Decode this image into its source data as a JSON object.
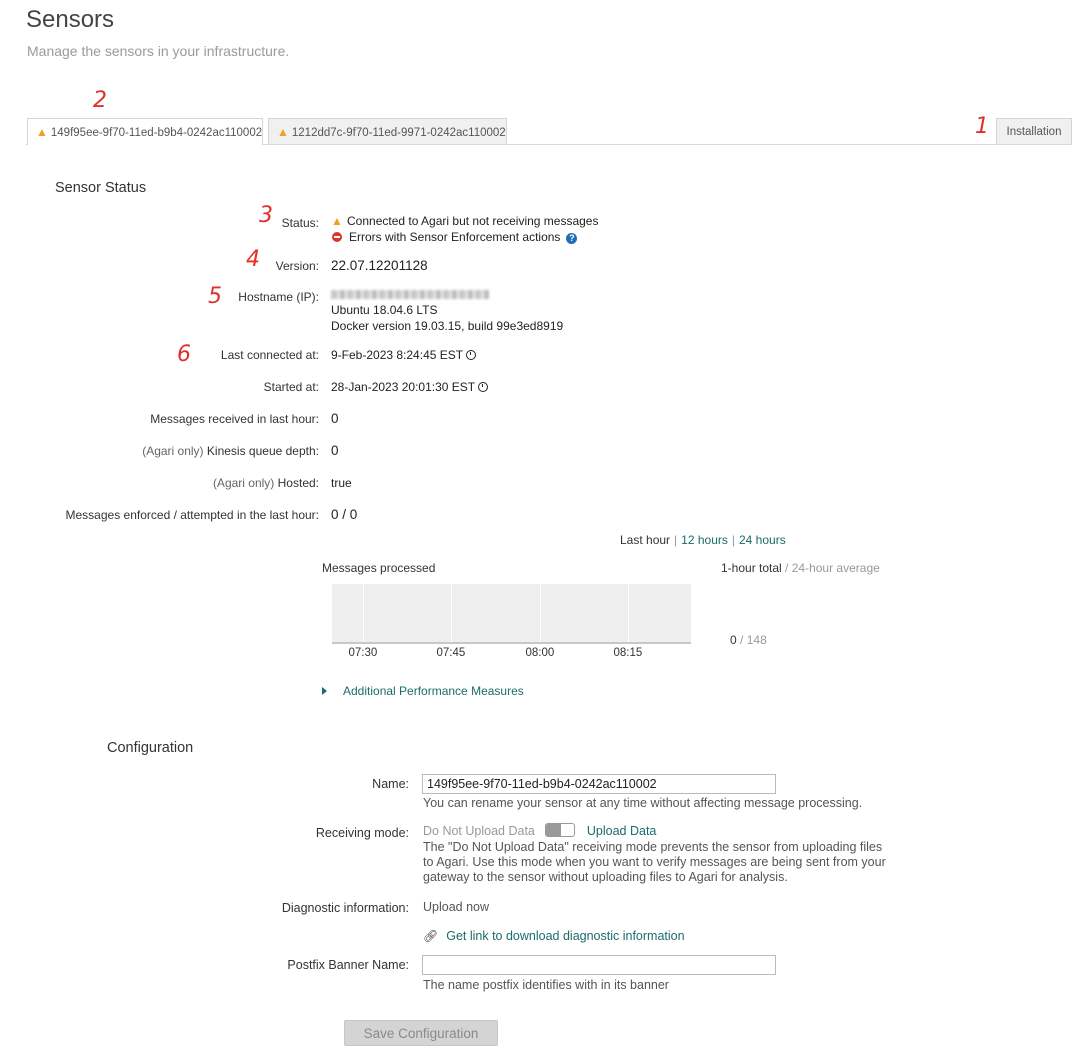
{
  "header": {
    "title": "Sensors",
    "subtitle": "Manage the sensors in your infrastructure."
  },
  "tabs": [
    {
      "label": "149f95ee-9f70-11ed-b9b4-0242ac110002",
      "status": "warning",
      "active": true
    },
    {
      "label": "1212dd7c-9f70-11ed-9971-0242ac110002",
      "status": "warning",
      "active": false
    }
  ],
  "installation_tab": "Installation",
  "annotations": [
    "1",
    "2",
    "3",
    "4",
    "5",
    "6"
  ],
  "sensor_status": {
    "title": "Sensor Status",
    "status_label": "Status:",
    "status_lines": [
      {
        "icon": "warning-icon",
        "text": "Connected to Agari but not receiving messages"
      },
      {
        "icon": "error-icon",
        "text": "Errors with Sensor Enforcement actions"
      }
    ],
    "version_label": "Version:",
    "version": "22.07.12201128",
    "hostname_label": "Hostname (IP):",
    "os": "Ubuntu 18.04.6 LTS",
    "docker": "Docker version 19.03.15, build 99e3ed8919",
    "last_connected_label": "Last connected at:",
    "last_connected": "9-Feb-2023 8:24:45 EST",
    "started_label": "Started at:",
    "started": "28-Jan-2023 20:01:30 EST",
    "messages_received_label": "Messages received in last hour:",
    "messages_received": "0",
    "kinesis_prefix": "(Agari only)",
    "kinesis_label": "Kinesis queue depth:",
    "kinesis": "0",
    "hosted_prefix": "(Agari only)",
    "hosted_label": "Hosted:",
    "hosted": "true",
    "enforced_label": "Messages enforced / attempted in the last hour:",
    "enforced": "0 / 0"
  },
  "range_selector": {
    "current": "Last hour",
    "options": [
      "12 hours",
      "24 hours"
    ]
  },
  "chart_data": {
    "type": "area",
    "title": "Messages processed",
    "x": [
      "07:30",
      "07:45",
      "08:00",
      "08:15"
    ],
    "series": [
      {
        "values": [
          0,
          0,
          0,
          0
        ]
      }
    ],
    "grid": true
  },
  "totals": {
    "header_total": "1-hour total",
    "header_avg": "24-hour average",
    "total": "0",
    "avg": "148"
  },
  "additional_measures": "Additional Performance Measures",
  "configuration": {
    "title": "Configuration",
    "name_label": "Name:",
    "name_value": "149f95ee-9f70-11ed-b9b4-0242ac110002",
    "name_help": "You can rename your sensor at any time without affecting message processing.",
    "receiving_label": "Receiving mode:",
    "mode_off": "Do Not Upload Data",
    "mode_on": "Upload Data",
    "mode_help_lines": [
      "The \"Do Not Upload Data\" receiving mode prevents the sensor from uploading files",
      "to Agari. Use this mode when you want to verify messages are being sent from your",
      "gateway to the sensor without uploading files to Agari for analysis."
    ],
    "diagnostic_label": "Diagnostic information:",
    "upload_now": "Upload now",
    "download_link": "Get link to download diagnostic information",
    "postfix_label": "Postfix Banner Name:",
    "postfix_value": "",
    "postfix_help": "The name postfix identifies with in its banner",
    "save_label": "Save Configuration"
  }
}
